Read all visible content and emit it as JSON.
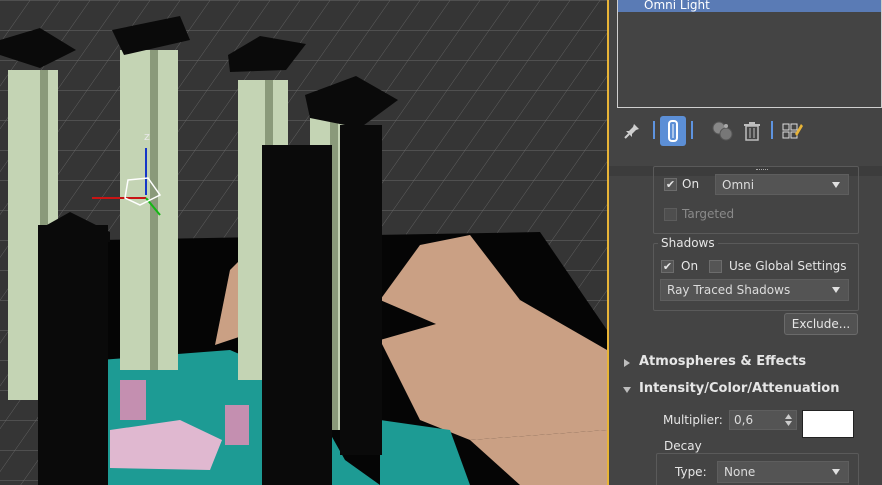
{
  "object_list": {
    "selected_item": "Omni Light"
  },
  "toolbar": {
    "icons": [
      "pin-icon",
      "modifier-stack-icon",
      "make-unique-icon",
      "trash-icon",
      "configure-sets-icon"
    ]
  },
  "general": {
    "on_label": "On",
    "light_type": "Omni",
    "targeted_label": "Targeted",
    "on_checked": true,
    "targeted_checked": false
  },
  "shadows": {
    "title": "Shadows",
    "on_label": "On",
    "on_checked": true,
    "global_label": "Use Global Settings",
    "global_checked": false,
    "type": "Ray Traced Shadows",
    "exclude_label": "Exclude..."
  },
  "sections": {
    "atmospheres": "Atmospheres & Effects",
    "intensity": "Intensity/Color/Attenuation"
  },
  "intensity": {
    "multiplier_label": "Multiplier:",
    "multiplier_value": "0,6",
    "color": "#ffffff"
  },
  "decay": {
    "title": "Decay",
    "type_label": "Type:",
    "type_value": "None"
  },
  "colors": {
    "viewport_border": "#e8b437",
    "accent": "#5c8fd6"
  }
}
